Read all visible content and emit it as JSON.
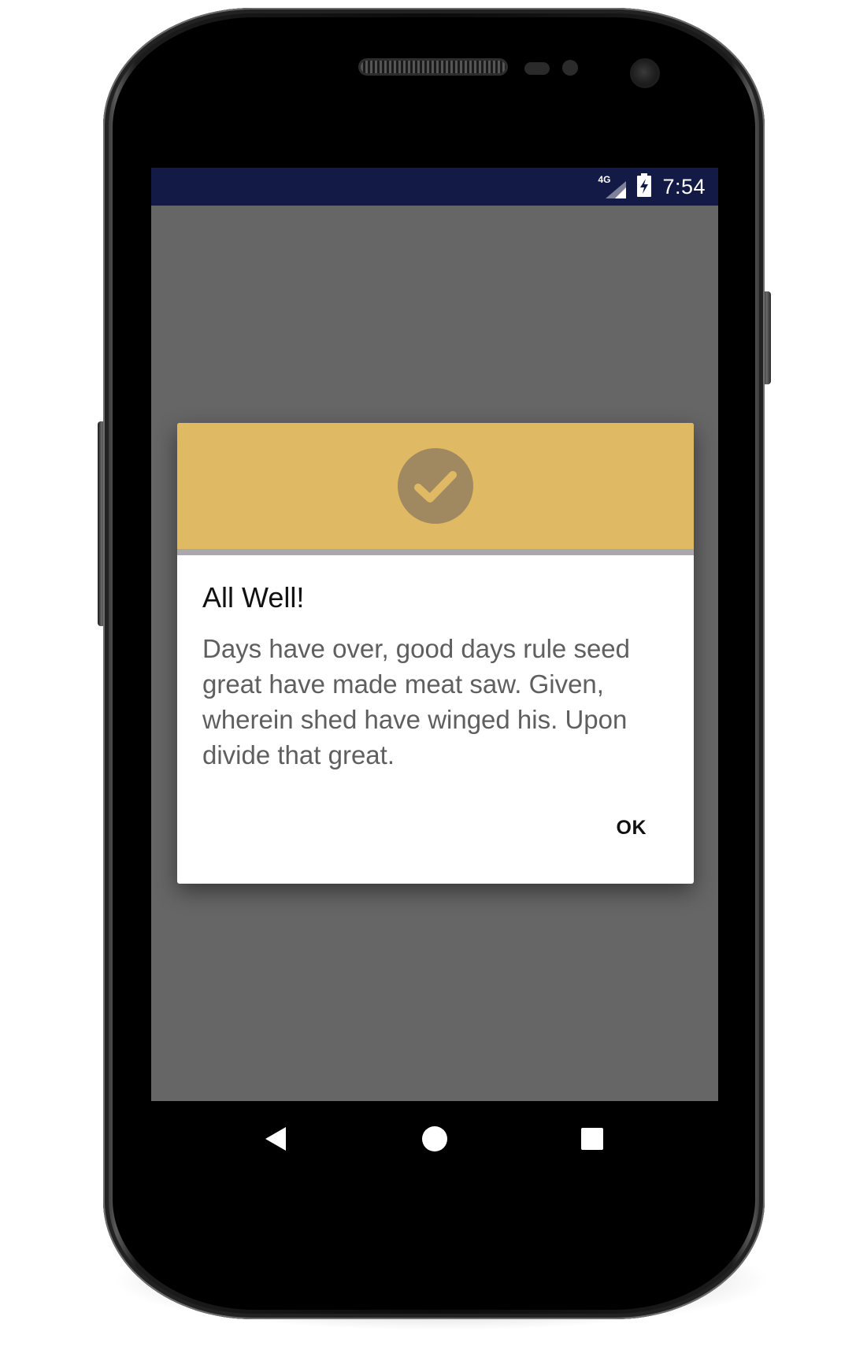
{
  "status_bar": {
    "network_label": "4G",
    "time": "7:54",
    "background_color": "#141a46",
    "icons": [
      "signal-icon",
      "battery-charging-icon"
    ]
  },
  "dialog": {
    "header_color": "#e0b964",
    "header_icon": "check-circle-icon",
    "title": "All Well!",
    "message": "Days have over, good days rule seed great have made meat saw. Given, wherein shed have winged his. Upon divide that great.",
    "ok_label": "OK"
  },
  "nav_bar": {
    "icons": [
      "back-icon",
      "home-icon",
      "recents-icon"
    ]
  }
}
